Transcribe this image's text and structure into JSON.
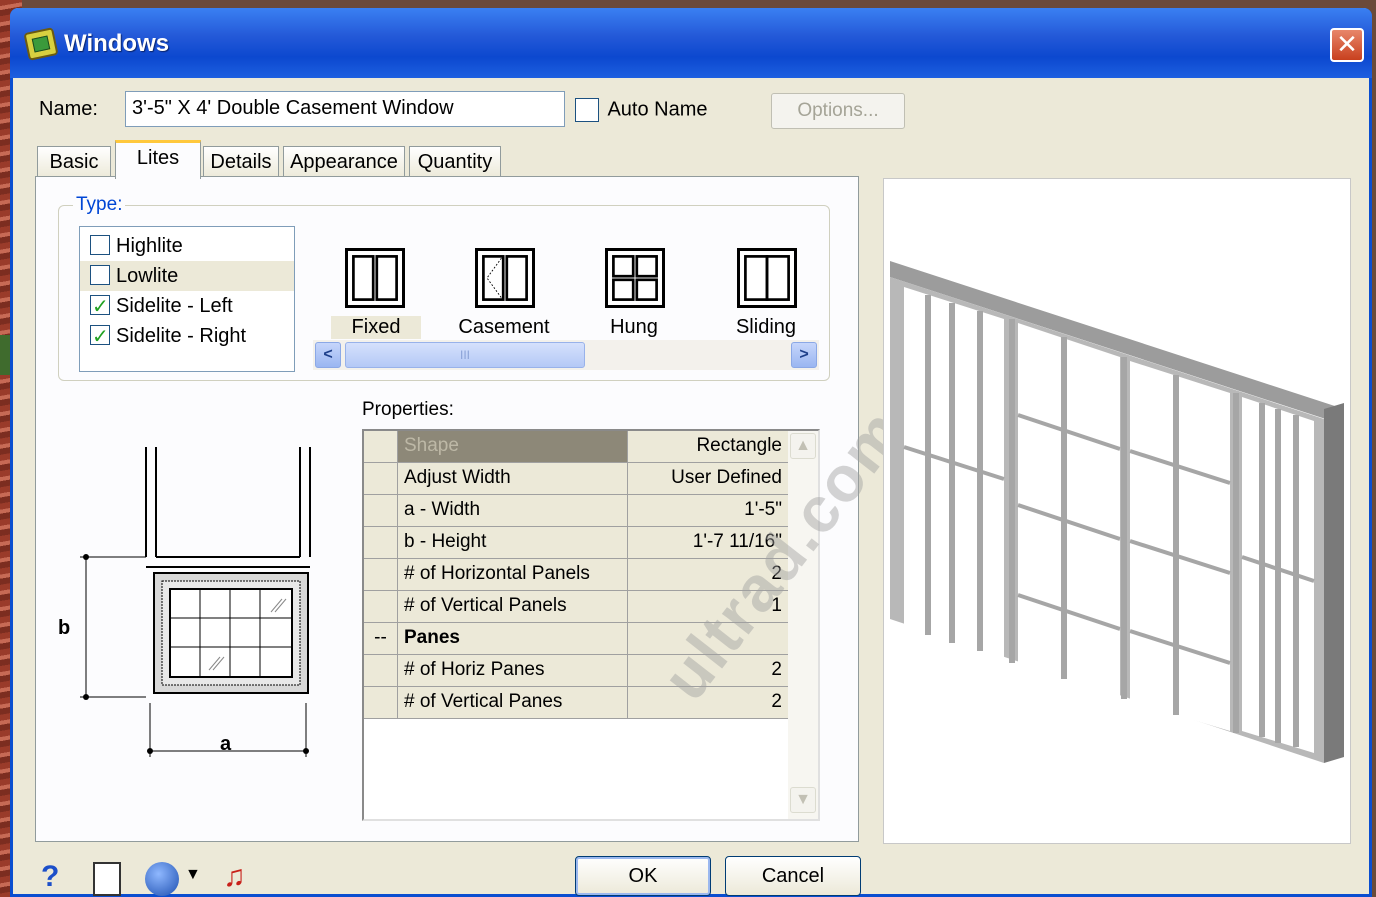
{
  "window": {
    "title": "Windows",
    "close_label": "✕"
  },
  "name_row": {
    "label": "Name:",
    "value": "3'-5\" X 4' Double Casement Window",
    "auto_name_label": "Auto Name",
    "auto_name_checked": false,
    "options_label": "Options..."
  },
  "tabs": [
    {
      "label": "Basic",
      "active": false
    },
    {
      "label": "Lites",
      "active": true
    },
    {
      "label": "Details",
      "active": false
    },
    {
      "label": "Appearance",
      "active": false
    },
    {
      "label": "Quantity",
      "active": false
    }
  ],
  "type_group": {
    "legend": "Type:",
    "lites": [
      {
        "label": "Highlite",
        "checked": false
      },
      {
        "label": "Lowlite",
        "checked": false
      },
      {
        "label": "Sidelite - Left",
        "checked": true
      },
      {
        "label": "Sidelite - Right",
        "checked": true
      }
    ],
    "styles": [
      {
        "label": "Fixed",
        "selected": true
      },
      {
        "label": "Casement",
        "selected": false
      },
      {
        "label": "Hung",
        "selected": false
      },
      {
        "label": "Sliding",
        "selected": false
      }
    ],
    "scroll_left": "<",
    "scroll_right": ">",
    "scroll_grip": "III"
  },
  "diagram": {
    "label_a": "a",
    "label_b": "b"
  },
  "properties": {
    "label": "Properties:",
    "rows": [
      {
        "key": "Shape",
        "value": "Rectangle",
        "gutter": ""
      },
      {
        "key": "Adjust Width",
        "value": "User Defined",
        "gutter": ""
      },
      {
        "key": "a - Width",
        "value": "1'-5\"",
        "gutter": ""
      },
      {
        "key": "b - Height",
        "value": "1'-7 11/16\"",
        "gutter": ""
      },
      {
        "key": "# of Horizontal Panels",
        "value": "2",
        "gutter": ""
      },
      {
        "key": "# of Vertical Panels",
        "value": "1",
        "gutter": ""
      },
      {
        "key": "Panes",
        "value": "",
        "gutter": "--"
      },
      {
        "key": "# of Horiz Panes",
        "value": "2",
        "gutter": ""
      },
      {
        "key": "# of Vertical Panes",
        "value": "2",
        "gutter": ""
      }
    ]
  },
  "watermark": "ultrad.com",
  "buttons": {
    "ok": "OK",
    "cancel": "Cancel"
  },
  "bottom_icons": {
    "help": "?",
    "sound": "♫"
  }
}
